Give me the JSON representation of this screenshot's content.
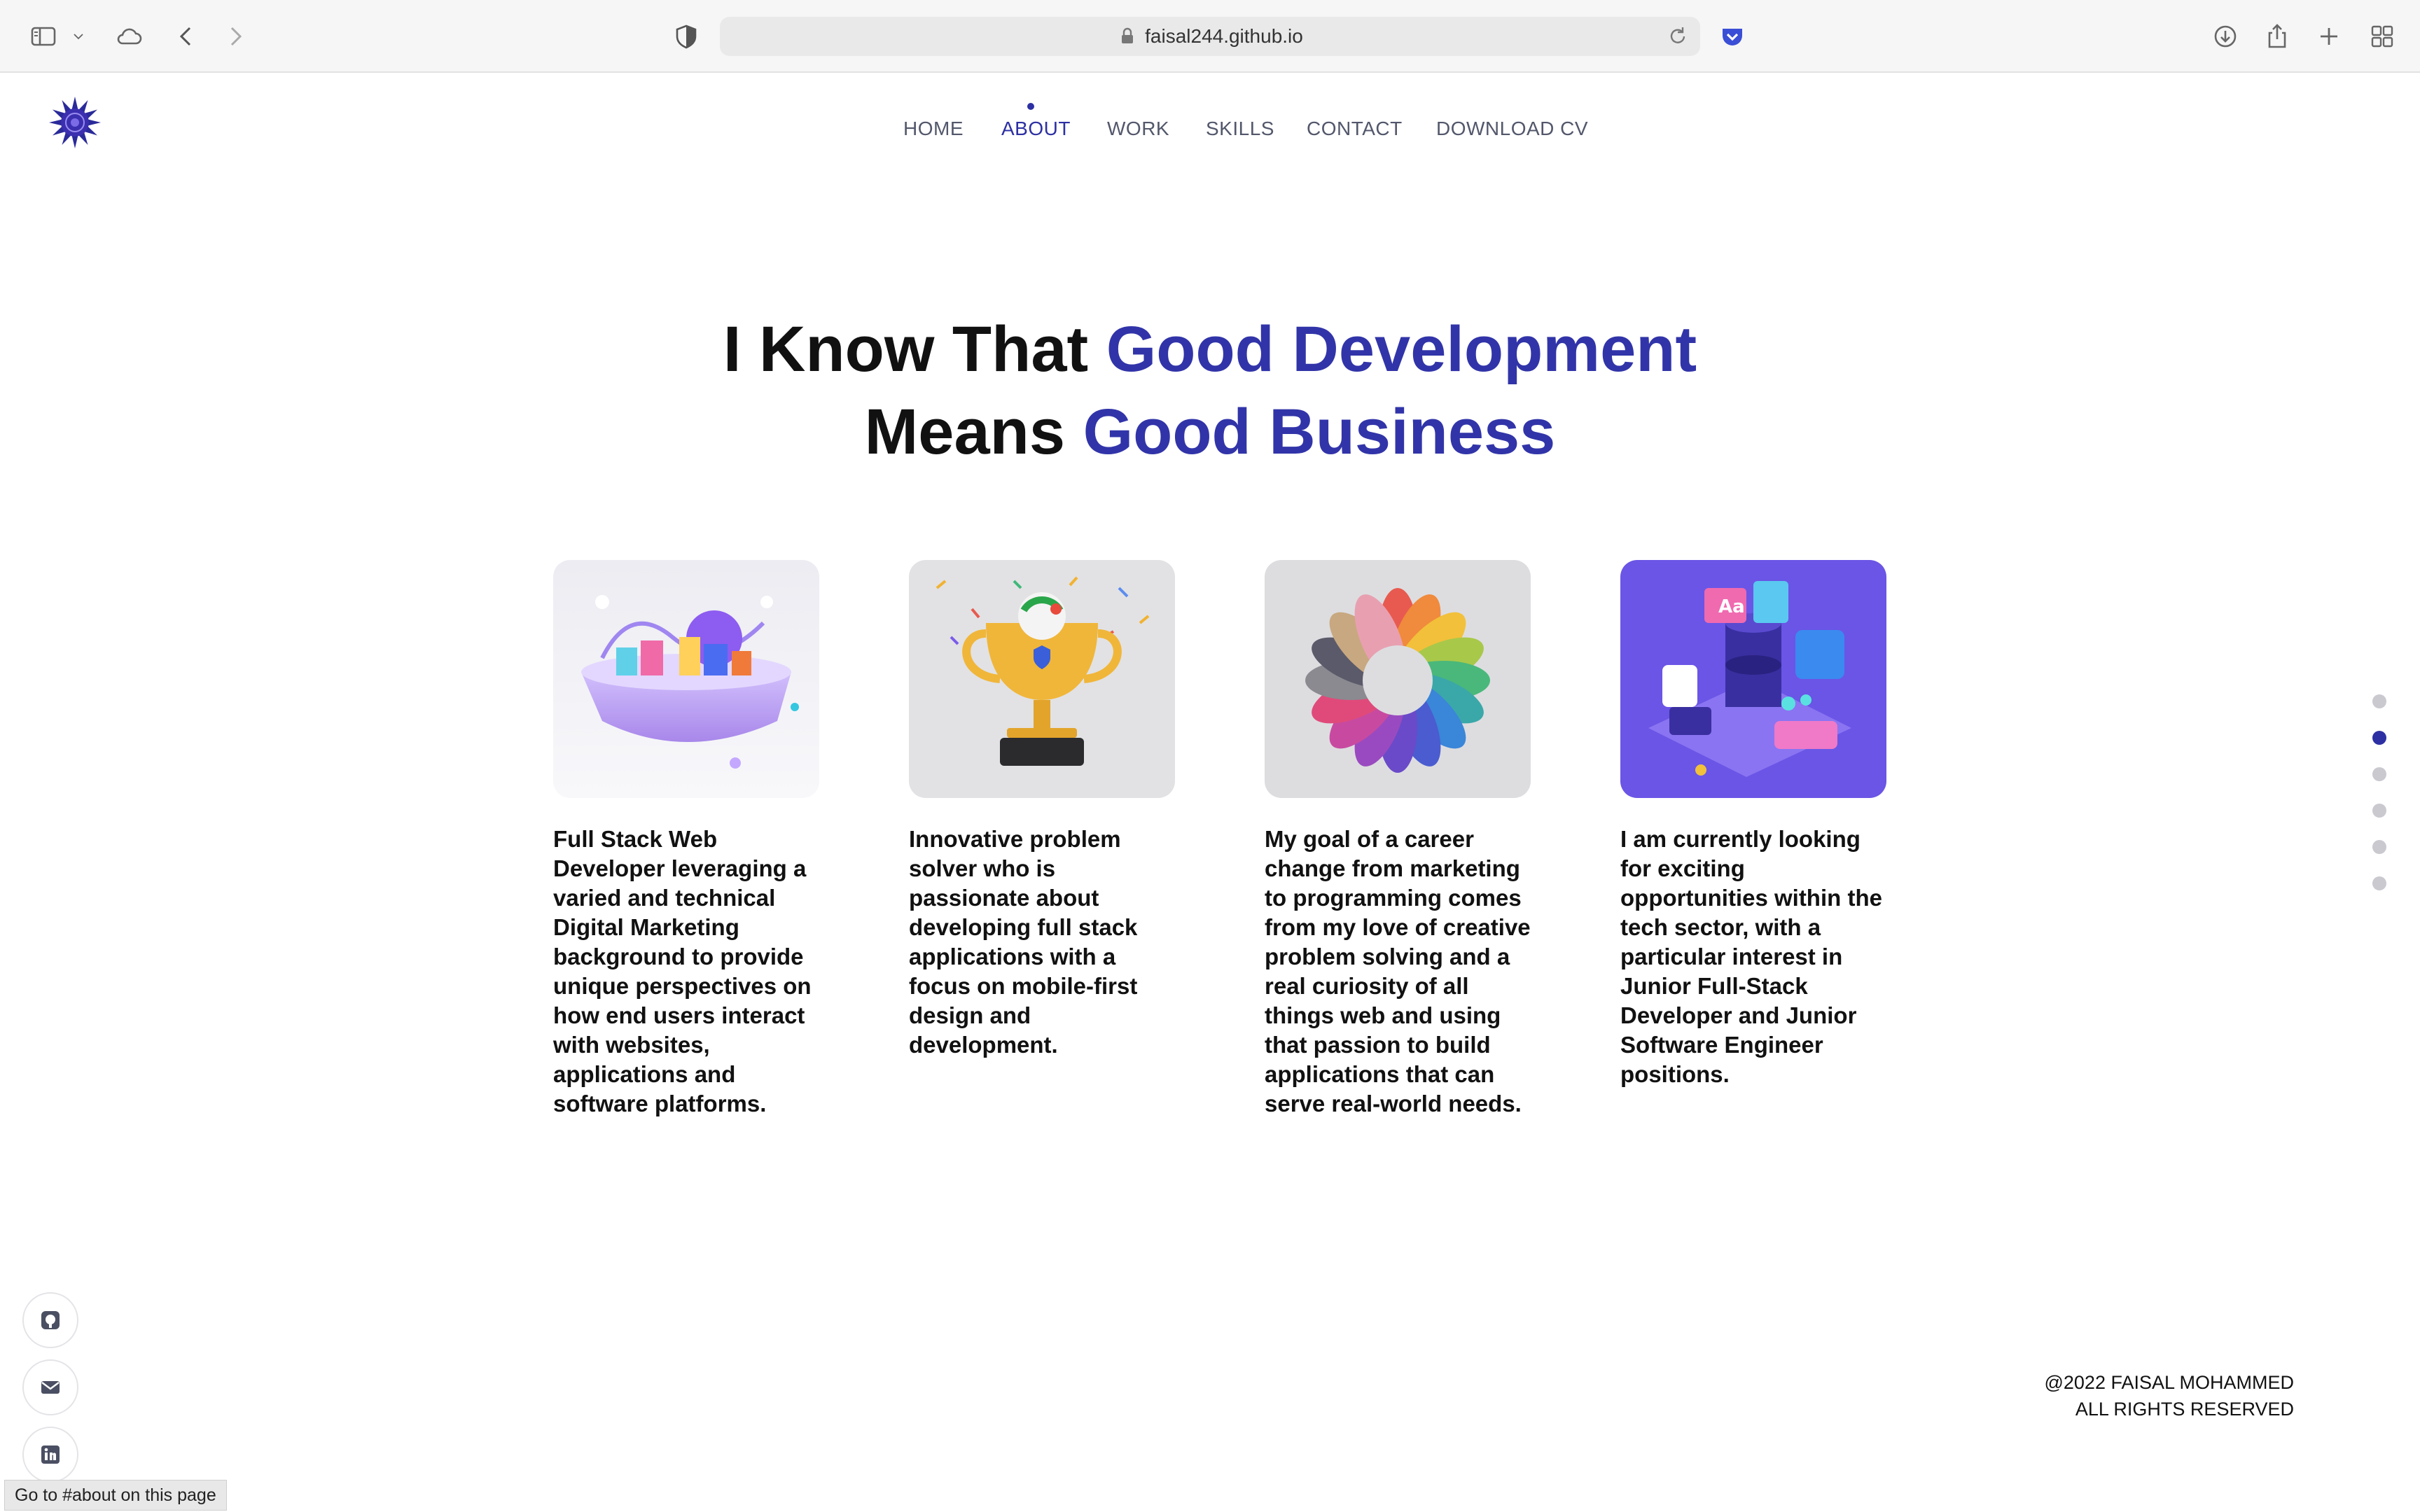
{
  "browser": {
    "url": "faisal244.github.io",
    "status_text": "Go to #about on this page"
  },
  "nav": {
    "items": [
      {
        "label": "HOME"
      },
      {
        "label": "ABOUT"
      },
      {
        "label": "WORK"
      },
      {
        "label": "SKILLS"
      },
      {
        "label": "CONTACT"
      },
      {
        "label": "DOWNLOAD CV"
      }
    ],
    "active": "ABOUT"
  },
  "hero": {
    "line1_plain": "I Know That ",
    "line1_accent": "Good Development",
    "line2_plain": "Means ",
    "line2_accent": "Good Business"
  },
  "cards": [
    {
      "text": "Full Stack Web Developer leveraging a varied and technical Digital Marketing background to provide unique perspectives on how end users interact with websites, applications and software platforms."
    },
    {
      "text": "Innovative problem solver who is passionate about developing full stack applications with a focus on mobile-first design and development."
    },
    {
      "text": "My goal of a career change from marketing to programming comes from my love of creative problem solving and a real curiosity of all things web and using that passion to build applications that can serve real-world needs."
    },
    {
      "text": "I am currently looking for exciting opportunities within the tech sector, with a particular interest in Junior Full-Stack Developer and Junior Software Engineer positions."
    }
  ],
  "footer": {
    "copyright_line1": "@2022 FAISAL MOHAMMED",
    "copyright_line2": "ALL RIGHTS RESERVED"
  },
  "colors": {
    "accent": "#3134a8",
    "nav_text": "#52576b",
    "pager_inactive": "#c9c9cf"
  },
  "icons": [
    "sidebar-icon",
    "chevron-down-icon",
    "cloud-icon",
    "back-icon",
    "forward-icon",
    "privacy-shield-icon",
    "lock-icon",
    "reload-icon",
    "pocket-icon",
    "download-icon",
    "share-icon",
    "plus-icon",
    "tabs-grid-icon",
    "github-icon",
    "mail-icon",
    "linkedin-icon"
  ],
  "pager": {
    "count": 6,
    "active_index": 1
  }
}
